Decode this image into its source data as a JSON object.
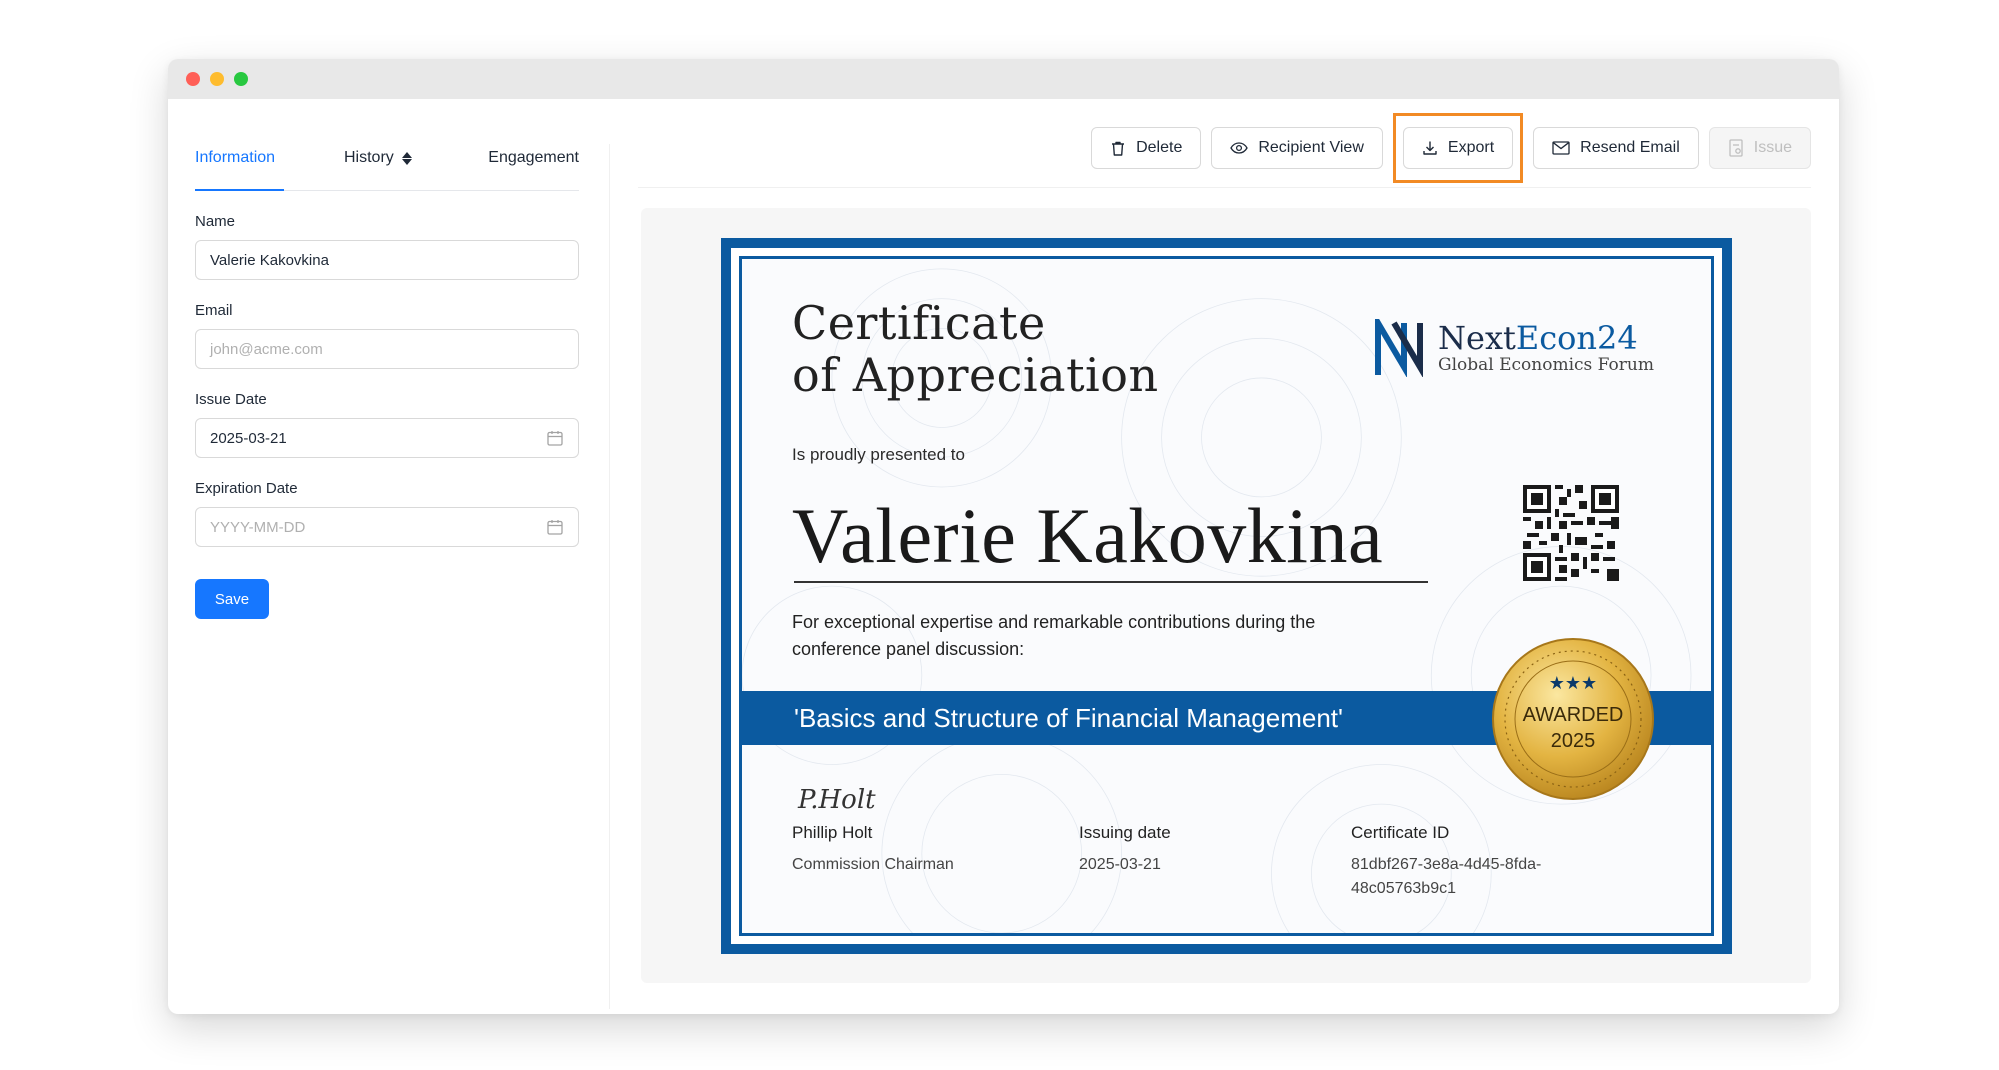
{
  "left_panel": {
    "tabs": [
      {
        "label": "Information"
      },
      {
        "label": "History"
      },
      {
        "label": "Engagement"
      }
    ],
    "fields": {
      "name_label": "Name",
      "name_value": "Valerie Kakovkina",
      "email_label": "Email",
      "email_placeholder": "john@acme.com",
      "issue_date_label": "Issue Date",
      "issue_date_value": "2025-03-21",
      "expiration_label": "Expiration Date",
      "expiration_placeholder": "YYYY-MM-DD"
    },
    "save_label": "Save"
  },
  "toolbar": {
    "delete": "Delete",
    "recipient_view": "Recipient View",
    "export": "Export",
    "resend_email": "Resend Email",
    "issue": "Issue"
  },
  "certificate": {
    "title_line1": "Certificate",
    "title_line2": "of Appreciation",
    "logo_name_a": "Next",
    "logo_name_b": "Econ24",
    "logo_sub": "Global Economics Forum",
    "presented": "Is proudly presented to",
    "recipient": "Valerie Kakovkina",
    "desc": "For exceptional expertise and remarkable contributions during the conference panel discussion:",
    "topic": "'Basics and Structure of Financial Management'",
    "seal_line1": "AWARDED",
    "seal_line2": "2025",
    "signature": "P.Holt",
    "signer_name": "Phillip Holt",
    "signer_title": "Commission Chairman",
    "issuing_label": "Issuing date",
    "issuing_value": "2025-03-21",
    "id_label": "Certificate ID",
    "id_value_line1": "81dbf267-3e8a-4d45-8fda-",
    "id_value_line2": "48c05763b9c1"
  },
  "colors": {
    "accent": "#1677ff",
    "cert_blue": "#0b5aa0",
    "highlight": "#f28a24"
  }
}
